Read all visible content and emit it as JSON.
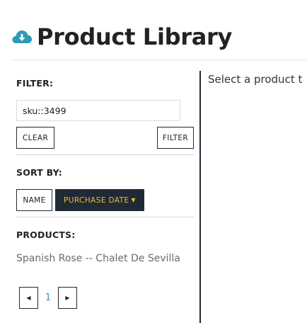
{
  "header": {
    "title": "Product Library",
    "icon": "cloud-download-icon",
    "icon_color": "#2b9bb6"
  },
  "filter": {
    "label": "FILTER:",
    "input_value": "sku::3499",
    "clear_label": "CLEAR",
    "apply_label": "FILTER"
  },
  "sort": {
    "label": "SORT BY:",
    "name_label": "NAME",
    "date_label": "PURCHASE DATE",
    "active": "purchase-date",
    "active_bg": "#1f2a36",
    "active_color": "#f4b731"
  },
  "products": {
    "label": "PRODUCTS:",
    "items": [
      "Spanish Rose -- Chalet De Sevilla"
    ]
  },
  "pagination": {
    "prev_icon": "triangle-left-icon",
    "current_page": "1",
    "next_icon": "triangle-right-icon",
    "page_color": "#3b8fc0"
  },
  "detail": {
    "placeholder": "Select a product t"
  }
}
